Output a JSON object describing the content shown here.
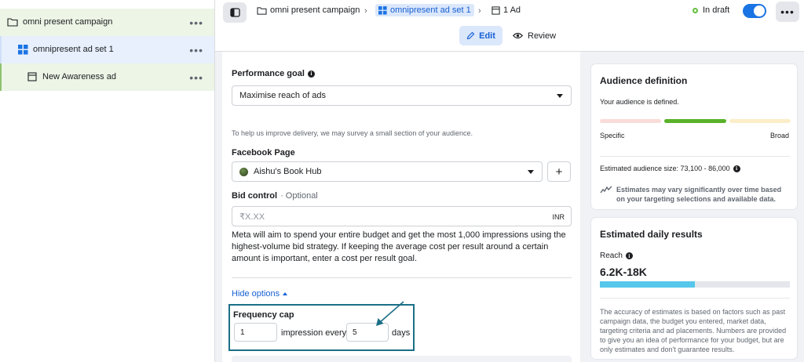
{
  "tree": {
    "campaign": "omni present campaign",
    "adset": "omnipresent ad set 1",
    "ad": "New Awareness ad",
    "more": "•••"
  },
  "topbar": {
    "breadcrumb_campaign": "omni present campaign",
    "breadcrumb_adset": "omnipresent ad set 1",
    "breadcrumb_ad": "1 Ad",
    "status": "In draft",
    "more": "•••",
    "edit": "Edit",
    "review": "Review"
  },
  "form": {
    "performance_goal_label": "Performance goal",
    "performance_goal_value": "Maximise reach of ads",
    "survey_note": "To help us improve delivery, we may survey a small section of your audience.",
    "facebook_page_label": "Facebook Page",
    "facebook_page_value": "Aishu's Book Hub",
    "bid_control_label": "Bid control",
    "bid_control_optional": "· Optional",
    "bid_placeholder": "₹X.XX",
    "currency": "INR",
    "bid_description": "Meta will aim to spend your entire budget and get the most 1,000 impressions using the highest-volume bid strategy. If keeping the average cost per result around a certain amount is important, enter a cost per result goal.",
    "hide_options": "Hide options",
    "frequency_cap_label": "Frequency cap",
    "frequency_impressions": "1",
    "frequency_middle": "impression every",
    "frequency_days": "5",
    "frequency_suffix": "days",
    "plus": "+"
  },
  "audience": {
    "title": "Audience definition",
    "defined": "Your audience is defined.",
    "specific": "Specific",
    "broad": "Broad",
    "size": "Estimated audience size: 73,100 - 86,000",
    "note": "Estimates may vary significantly over time based on your targeting selections and available data.",
    "colors": {
      "left": "#f9dcd9",
      "middle": "#5ab12a",
      "right": "#fbeec9"
    }
  },
  "daily": {
    "title": "Estimated daily results",
    "reach_label": "Reach",
    "reach_value": "6.2K-18K",
    "reach_fill_fraction": 0.5,
    "note": "The accuracy of estimates is based on factors such as past campaign data, the budget you entered, market data, targeting criteria and ad placements. Numbers are provided to give you an idea of performance for your budget, but are only estimates and don't guarantee results."
  },
  "icons": [
    "folder-icon",
    "grid-icon",
    "ad-icon",
    "sidebar-icon",
    "chevron-right-icon",
    "pencil-icon",
    "eye-icon",
    "info-icon",
    "trend-icon",
    "caret-down-icon",
    "caret-up-icon",
    "arrow-annotation"
  ]
}
